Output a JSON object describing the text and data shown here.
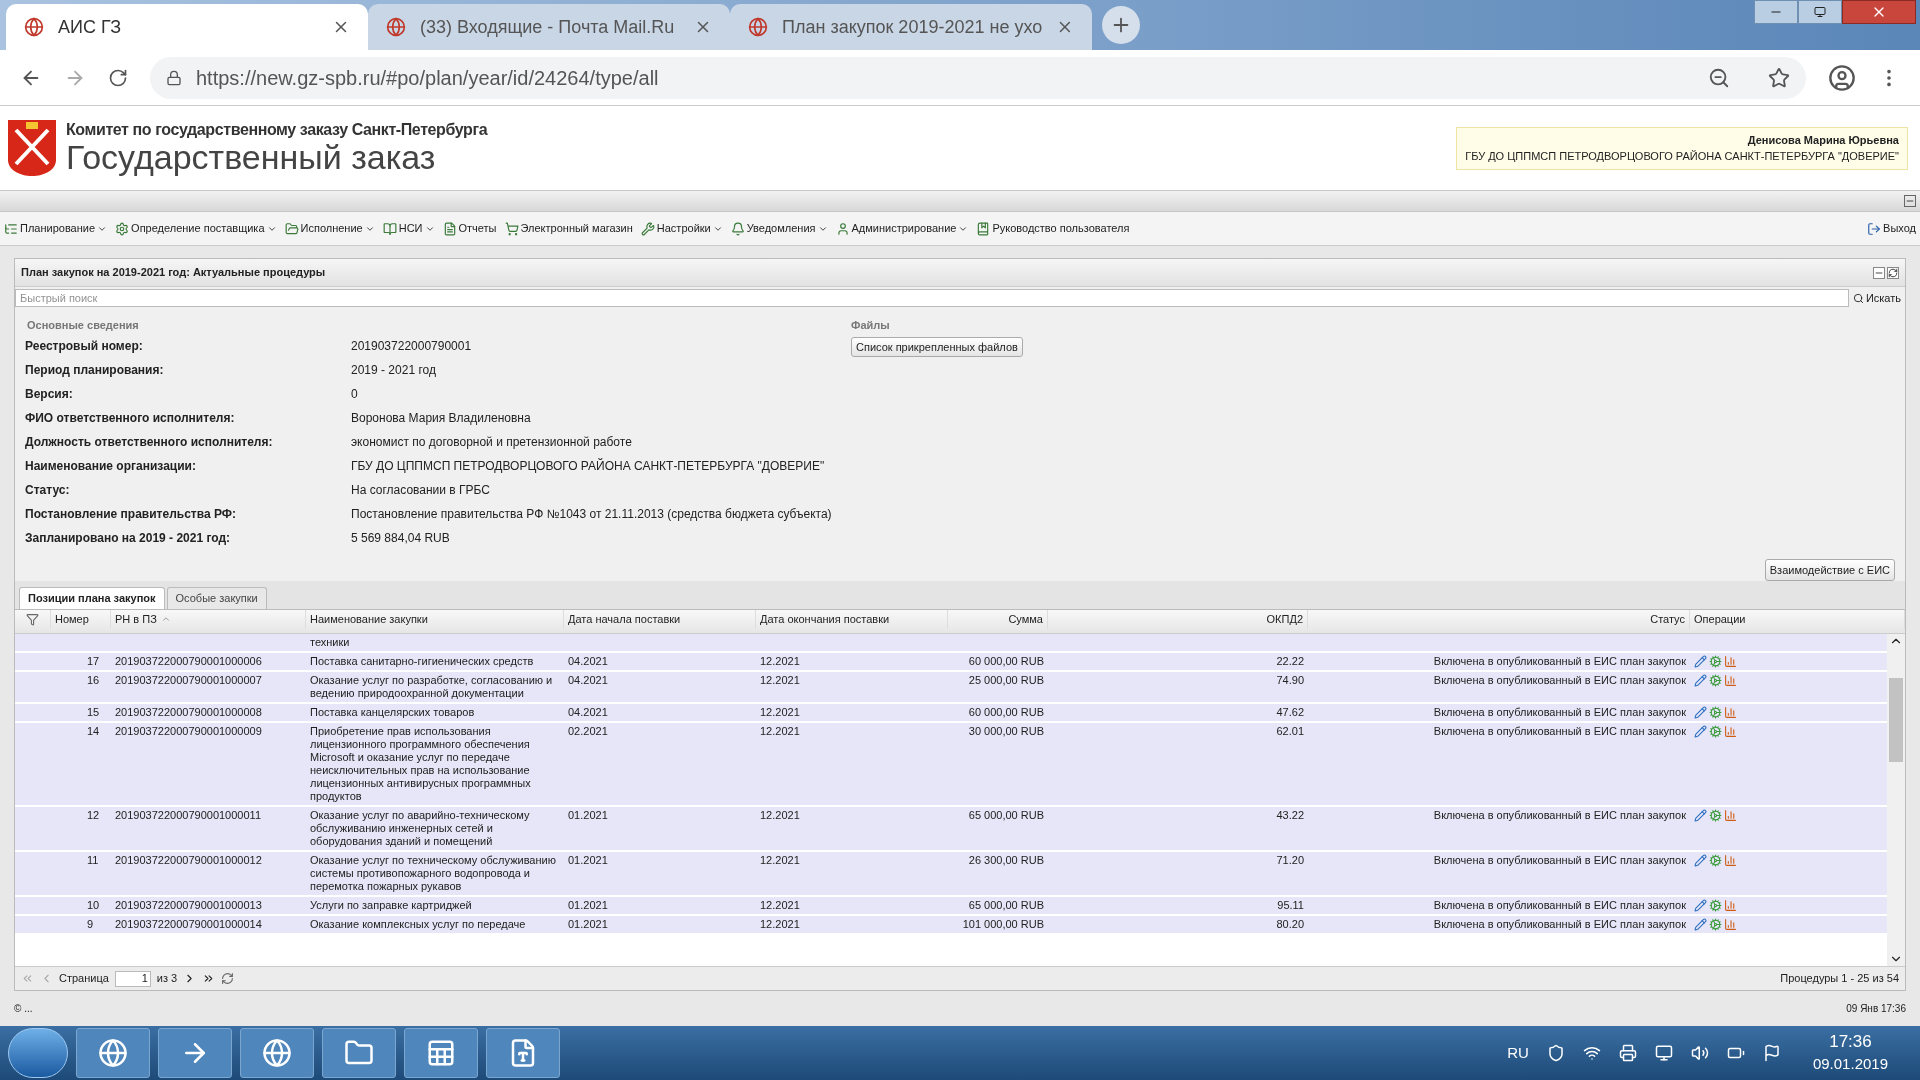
{
  "browser": {
    "tabs": [
      {
        "title": "АИС ГЗ",
        "selected": true
      },
      {
        "title": "(33) Входящие - Почта Mail.Ru",
        "selected": false
      },
      {
        "title": "План закупок 2019-2021 не ухо",
        "selected": false
      }
    ],
    "url": "https://new.gz-spb.ru/#po/plan/year/id/24264/type/all"
  },
  "header": {
    "subtitle": "Комитет по государственному заказу Санкт-Петербурга",
    "title": "Государственный заказ",
    "user_name": "Денисова Марина Юрьевна",
    "user_org": "ГБУ ДО ЦППМСП ПЕТРОДВОРЦОВОГО РАЙОНА САНКТ-ПЕТЕРБУРГА \"ДОВЕРИЕ\""
  },
  "menu": [
    {
      "label": "Планирование",
      "has_menu": true
    },
    {
      "label": "Определение поставщика",
      "has_menu": true
    },
    {
      "label": "Исполнение",
      "has_menu": true
    },
    {
      "label": "НСИ",
      "has_menu": true
    },
    {
      "label": "Отчеты",
      "has_menu": false
    },
    {
      "label": "Электронный магазин",
      "has_menu": false
    },
    {
      "label": "Настройки",
      "has_menu": true
    },
    {
      "label": "Уведомления",
      "has_menu": true
    },
    {
      "label": "Администрирование",
      "has_menu": true
    },
    {
      "label": "Руководство пользователя",
      "has_menu": false
    }
  ],
  "logout": "Выход",
  "panel": {
    "title": "План закупок на 2019-2021 год: Актуальные процедуры",
    "search_placeholder": "Быстрый поиск",
    "search_button": "Искать",
    "section": "Основные сведения",
    "fields": [
      {
        "label": "Реестровый номер:",
        "value": "201903722000790001"
      },
      {
        "label": "Период планирования:",
        "value": "2019 - 2021 год"
      },
      {
        "label": "Версия:",
        "value": "0"
      },
      {
        "label": "ФИО ответственного исполнителя:",
        "value": "Воронова Мария Владиленовна"
      },
      {
        "label": "Должность ответственного исполнителя:",
        "value": "экономист по договорной и претензионной работе"
      },
      {
        "label": "Наименование организации:",
        "value": "ГБУ ДО ЦППМСП ПЕТРОДВОРЦОВОГО РАЙОНА САНКТ-ПЕТЕРБУРГА \"ДОВЕРИЕ\""
      },
      {
        "label": "Статус:",
        "value": "На согласовании в ГРБС"
      },
      {
        "label": "Постановление правительства РФ:",
        "value": "Постановление правительства РФ №1043 от 21.11.2013 (средства бюджета субъекта)"
      },
      {
        "label": "Запланировано на 2019 - 2021 год:",
        "value": "5 569 884,04 RUB"
      }
    ],
    "files_title": "Файлы",
    "files_button": "Список прикрепленных файлов",
    "eis_button": "Взаимодействие с ЕИС"
  },
  "tabs": [
    {
      "label": "Позиции плана закупок",
      "selected": true
    },
    {
      "label": "Особые закупки",
      "selected": false
    }
  ],
  "table": {
    "columns": [
      {
        "label": "Номер",
        "sorted": false
      },
      {
        "label": "РН в ПЗ",
        "sorted": true
      },
      {
        "label": "Наименование закупки",
        "sorted": false
      },
      {
        "label": "Дата начала поставки",
        "sorted": false
      },
      {
        "label": "Дата окончания поставки",
        "sorted": false
      },
      {
        "label": "Сумма",
        "sorted": false
      },
      {
        "label": "ОКПД2",
        "sorted": false
      },
      {
        "label": "Статус",
        "sorted": false
      },
      {
        "label": "Операции",
        "sorted": false
      }
    ],
    "rows": [
      {
        "name": "техники"
      },
      {
        "number": "17",
        "rn": "201903722000790001000006",
        "name": "Поставка санитарно-гигиенических средств",
        "start": "04.2021",
        "end": "12.2021",
        "sum": "60 000,00 RUB",
        "okpd": "22.22",
        "status": "Включена в опубликованный в ЕИС план закупок"
      },
      {
        "number": "16",
        "rn": "201903722000790001000007",
        "name": "Оказание услуг по разработке, согласованию и ведению природоохранной документации",
        "start": "04.2021",
        "end": "12.2021",
        "sum": "25 000,00 RUB",
        "okpd": "74.90",
        "status": "Включена в опубликованный в ЕИС план закупок"
      },
      {
        "number": "15",
        "rn": "201903722000790001000008",
        "name": "Поставка канцелярских товаров",
        "start": "04.2021",
        "end": "12.2021",
        "sum": "60 000,00 RUB",
        "okpd": "47.62",
        "status": "Включена в опубликованный в ЕИС план закупок"
      },
      {
        "number": "14",
        "rn": "201903722000790001000009",
        "name": "Приобретение прав использования лицензионного программного обеспечения Microsoft и оказание услуг по передаче неисключительных прав на использование лицензионных антивирусных программных продуктов",
        "start": "02.2021",
        "end": "12.2021",
        "sum": "30 000,00 RUB",
        "okpd": "62.01",
        "status": "Включена в опубликованный в ЕИС план закупок"
      },
      {
        "number": "12",
        "rn": "201903722000790001000011",
        "name": "Оказание услуг по аварийно-техническому обслуживанию инженерных сетей и оборудования зданий и помещений",
        "start": "01.2021",
        "end": "12.2021",
        "sum": "65 000,00 RUB",
        "okpd": "43.22",
        "status": "Включена в опубликованный в ЕИС план закупок"
      },
      {
        "number": "11",
        "rn": "201903722000790001000012",
        "name": "Оказание услуг по техническому обслуживанию системы противопожарного водопровода и перемотка пожарных рукавов",
        "start": "01.2021",
        "end": "12.2021",
        "sum": "26 300,00 RUB",
        "okpd": "71.20",
        "status": "Включена в опубликованный в ЕИС план закупок"
      },
      {
        "number": "10",
        "rn": "201903722000790001000013",
        "name": "Услуги по заправке картриджей",
        "start": "01.2021",
        "end": "12.2021",
        "sum": "65 000,00 RUB",
        "okpd": "95.11",
        "status": "Включена в опубликованный в ЕИС план закупок"
      },
      {
        "number": "9",
        "rn": "201903722000790001000014",
        "name": "Оказание комплексных услуг по передаче",
        "start": "01.2021",
        "end": "12.2021",
        "sum": "101 000,00 RUB",
        "okpd": "80.20",
        "status": "Включена в опубликованный в ЕИС план закупок"
      }
    ]
  },
  "pager": {
    "page_label": "Страница",
    "page": "1",
    "of": "из 3",
    "summary": "Процедуры 1 - 25 из 54"
  },
  "footer": {
    "left": "© ...",
    "right": "09 Янв 17:36"
  },
  "taskbar": {
    "lang": "RU",
    "time": "17:36",
    "date": "09.01.2019"
  }
}
